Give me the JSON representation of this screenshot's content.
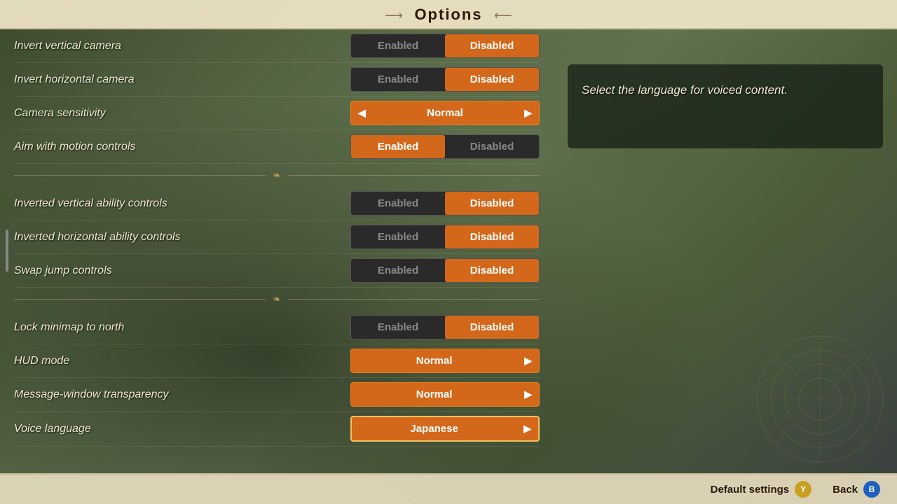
{
  "header": {
    "title": "Options",
    "deco_left": "➔",
    "deco_right": "➔"
  },
  "settings": {
    "groups": [
      {
        "id": "camera",
        "items": [
          {
            "id": "invert_vertical",
            "label": "Invert vertical camera",
            "type": "toggle",
            "value": "Disabled",
            "options": [
              "Enabled",
              "Disabled"
            ]
          },
          {
            "id": "invert_horizontal",
            "label": "Invert horizontal camera",
            "type": "toggle",
            "value": "Disabled",
            "options": [
              "Enabled",
              "Disabled"
            ]
          },
          {
            "id": "camera_sensitivity",
            "label": "Camera sensitivity",
            "type": "selector",
            "value": "Normal"
          },
          {
            "id": "aim_motion",
            "label": "Aim with motion controls",
            "type": "toggle",
            "value": "Enabled",
            "options": [
              "Enabled",
              "Disabled"
            ]
          }
        ]
      },
      {
        "id": "ability",
        "items": [
          {
            "id": "invert_vertical_ability",
            "label": "Inverted vertical ability controls",
            "type": "toggle",
            "value": "Disabled",
            "options": [
              "Enabled",
              "Disabled"
            ]
          },
          {
            "id": "invert_horizontal_ability",
            "label": "Inverted horizontal ability controls",
            "type": "toggle",
            "value": "Disabled",
            "options": [
              "Enabled",
              "Disabled"
            ]
          },
          {
            "id": "swap_jump",
            "label": "Swap jump controls",
            "type": "toggle",
            "value": "Disabled",
            "options": [
              "Enabled",
              "Disabled"
            ]
          }
        ]
      },
      {
        "id": "ui",
        "items": [
          {
            "id": "lock_minimap",
            "label": "Lock minimap to north",
            "type": "toggle",
            "value": "Disabled",
            "options": [
              "Enabled",
              "Disabled"
            ]
          },
          {
            "id": "hud_mode",
            "label": "HUD mode",
            "type": "selector",
            "value": "Normal"
          },
          {
            "id": "message_transparency",
            "label": "Message-window transparency",
            "type": "selector",
            "value": "Normal"
          },
          {
            "id": "voice_language",
            "label": "Voice language",
            "type": "selector",
            "value": "Japanese",
            "selected": true
          }
        ]
      }
    ]
  },
  "info_panel": {
    "text": "Select the language for voiced content."
  },
  "bottom": {
    "default_settings": "Default settings",
    "back": "Back",
    "default_btn_icon": "Y",
    "back_btn_icon": "B"
  }
}
